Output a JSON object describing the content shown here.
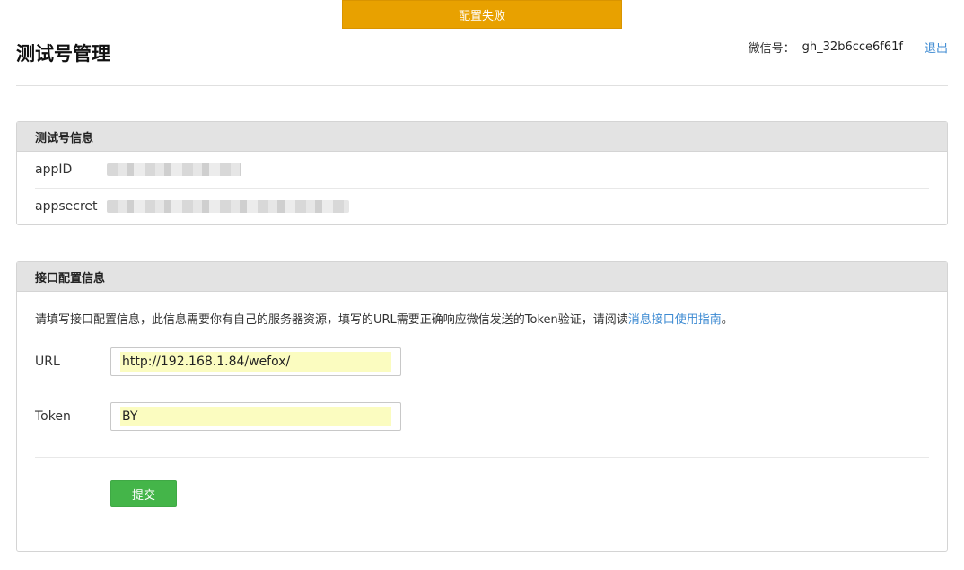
{
  "alert": {
    "text": "配置失败"
  },
  "header": {
    "title": "测试号管理",
    "account_label": "微信号：",
    "account_id": "gh_32b6cce6f61f",
    "logout": "退出"
  },
  "info_panel": {
    "title": "测试号信息",
    "rows": [
      {
        "label": "appID"
      },
      {
        "label": "appsecret"
      }
    ]
  },
  "config_panel": {
    "title": "接口配置信息",
    "description": "请填写接口配置信息，此信息需要你有自己的服务器资源，填写的URL需要正确响应微信发送的Token验证，请阅读",
    "guide_link": "消息接口使用指南",
    "description_end": "。",
    "url_label": "URL",
    "url_value": "http://192.168.1.84/wefox/",
    "token_label": "Token",
    "token_value": "BY",
    "submit": "提交"
  },
  "colors": {
    "alert": "#e8a100",
    "link": "#3c8ad2",
    "submit": "#44b549",
    "autofill": "#fbfcc0"
  }
}
